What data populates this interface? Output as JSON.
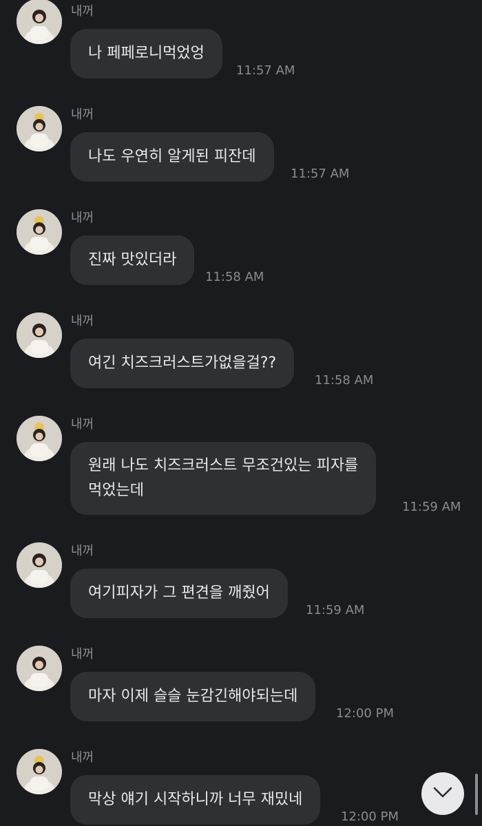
{
  "colors": {
    "background": "#1a1b1e",
    "bubble": "#2f3034",
    "sender_text": "#8e8f94",
    "time_text": "#8a8b90",
    "scroll_button": "#e9e9eb"
  },
  "messages": [
    {
      "sender": "내꺼",
      "text": "나 페페로니먹었엉",
      "time": "11:57 AM"
    },
    {
      "sender": "내꺼",
      "text": "나도 우연히 알게된 피잔데",
      "time": "11:57 AM"
    },
    {
      "sender": "내꺼",
      "text": "진짜 맛있더라",
      "time": "11:58 AM"
    },
    {
      "sender": "내꺼",
      "text": "여긴 치즈크러스트가없을걸??",
      "time": "11:58 AM"
    },
    {
      "sender": "내꺼",
      "text": "원래 나도 치즈크러스트 무조건있는 피자를\n먹었는데",
      "time": "11:59 AM"
    },
    {
      "sender": "내꺼",
      "text": "여기피자가 그 편견을 깨줬어",
      "time": "11:59 AM"
    },
    {
      "sender": "내꺼",
      "text": "마자 이제 슬슬 눈감긴해야되는데",
      "time": "12:00 PM"
    },
    {
      "sender": "내꺼",
      "text": "막상 얘기 시작하니까 너무 재밌네",
      "time": "12:00 PM"
    }
  ],
  "scroll_button": {
    "icon": "chevron-down-icon"
  }
}
